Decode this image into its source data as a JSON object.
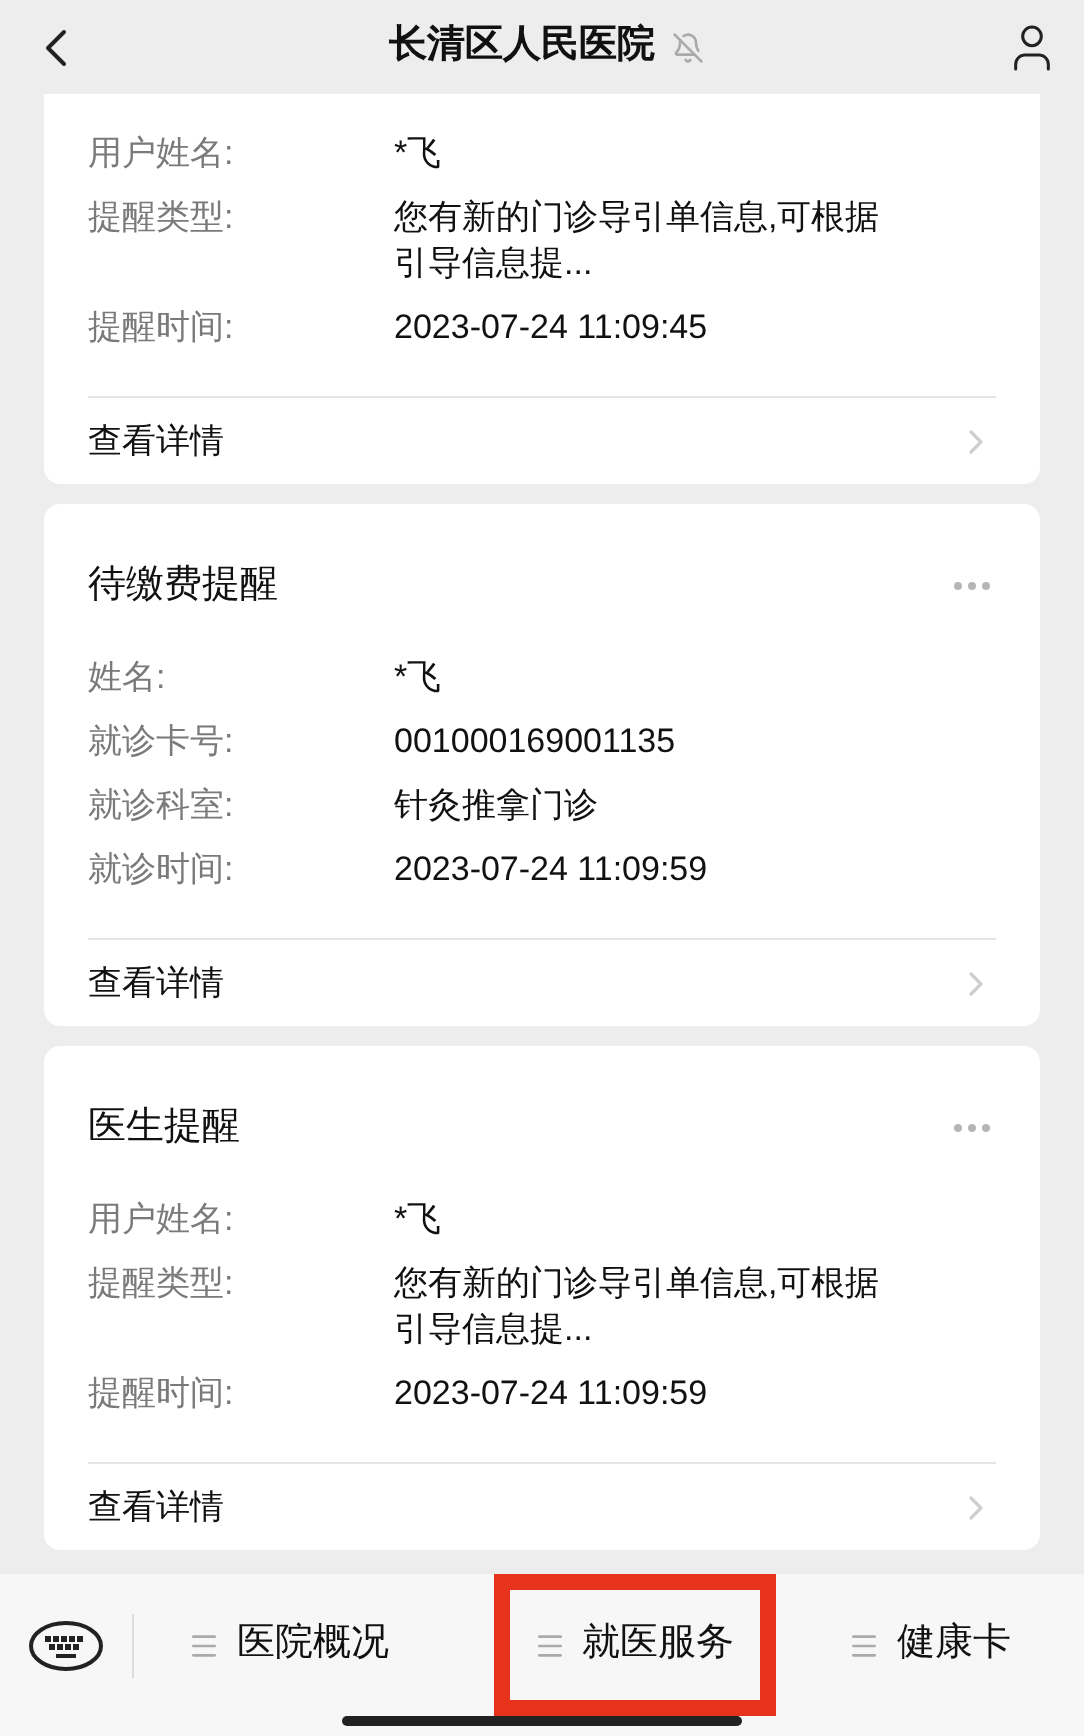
{
  "header": {
    "title": "长清区人民医院",
    "muted": true
  },
  "cards": [
    {
      "rows": [
        {
          "label": "用户姓名:",
          "value": "*飞"
        },
        {
          "label": "提醒类型:",
          "value": "您有新的门诊导引单信息,可根据引导信息提..."
        },
        {
          "label": "提醒时间:",
          "value": "2023-07-24 11:09:45"
        }
      ],
      "link": "查看详情"
    },
    {
      "title": "待缴费提醒",
      "rows": [
        {
          "label": "姓名:",
          "value": "*飞"
        },
        {
          "label": "就诊卡号:",
          "value": "001000169001135"
        },
        {
          "label": "就诊科室:",
          "value": "针灸推拿门诊"
        },
        {
          "label": "就诊时间:",
          "value": "2023-07-24 11:09:59"
        }
      ],
      "link": "查看详情"
    },
    {
      "title": "医生提醒",
      "rows": [
        {
          "label": "用户姓名:",
          "value": "*飞"
        },
        {
          "label": "提醒类型:",
          "value": "您有新的门诊导引单信息,可根据引导信息提..."
        },
        {
          "label": "提醒时间:",
          "value": "2023-07-24 11:09:59"
        }
      ],
      "link": "查看详情"
    }
  ],
  "menu": [
    {
      "label": "医院概况",
      "highlighted": false
    },
    {
      "label": "就医服务",
      "highlighted": true
    },
    {
      "label": "健康卡",
      "highlighted": false
    }
  ]
}
